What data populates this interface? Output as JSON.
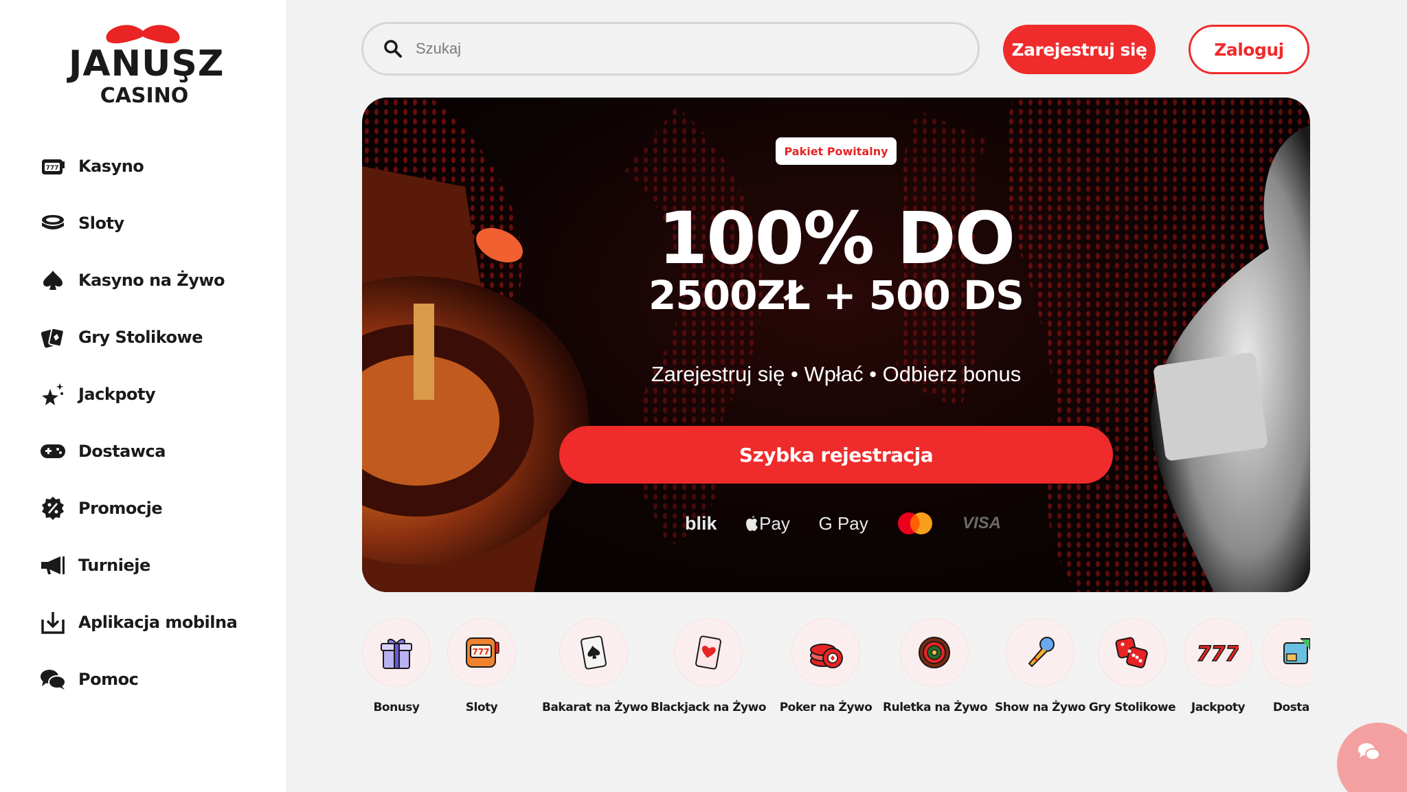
{
  "brand": {
    "name": "JANUŞZ",
    "sub": "CASINO",
    "accent": "#ef2b2b"
  },
  "sidebar": {
    "items": [
      {
        "label": "Kasyno",
        "icon": "slot-machine-icon"
      },
      {
        "label": "Sloty",
        "icon": "coin-stack-icon"
      },
      {
        "label": "Kasyno na Żywo",
        "icon": "spade-icon"
      },
      {
        "label": "Gry Stolikowe",
        "icon": "cards-icon"
      },
      {
        "label": "Jackpoty",
        "icon": "stars-icon"
      },
      {
        "label": "Dostawca",
        "icon": "gamepad-icon"
      },
      {
        "label": "Promocje",
        "icon": "percent-badge-icon"
      },
      {
        "label": "Turnieje",
        "icon": "megaphone-icon"
      },
      {
        "label": "Aplikacja mobilna",
        "icon": "download-icon"
      },
      {
        "label": "Pomoc",
        "icon": "chat-bubbles-icon"
      }
    ]
  },
  "header": {
    "search_placeholder": "Szukaj",
    "register_label": "Zarejestruj się",
    "login_label": "Zaloguj"
  },
  "banner": {
    "badge": "Pakiet Powitalny",
    "headline": "100% DO",
    "subline": "2500ZŁ + 500 DS",
    "steps": "Zarejestruj się • Wpłać • Odbierz bonus",
    "cta": "Szybka rejestracja",
    "payments": [
      "blik",
      " Pay",
      "G Pay",
      "VISA"
    ]
  },
  "categories": [
    {
      "label": "Bonusy",
      "icon": "gift-icon"
    },
    {
      "label": "Sloty",
      "icon": "slot-machine-icon"
    },
    {
      "label": "Bakarat na Żywo",
      "icon": "spade-card-icon"
    },
    {
      "label": "Blackjack na Żywo",
      "icon": "heart-card-icon"
    },
    {
      "label": "Poker na Żywo",
      "icon": "poker-chips-icon"
    },
    {
      "label": "Ruletka na Żywo",
      "icon": "roulette-icon"
    },
    {
      "label": "Show na Żywo",
      "icon": "microphone-icon"
    },
    {
      "label": "Gry Stolikowe",
      "icon": "dice-icon"
    },
    {
      "label": "Jackpoty",
      "icon": "lucky-777-icon"
    },
    {
      "label": "Dostaw",
      "icon": "provider-icon"
    }
  ]
}
